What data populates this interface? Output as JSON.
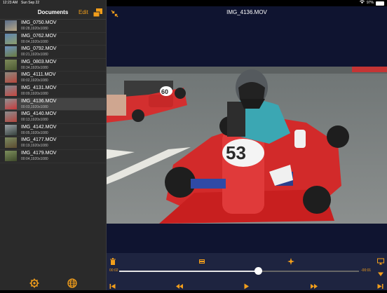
{
  "status": {
    "time": "12:23 AM",
    "date": "Sun Sep 22",
    "battery": "97%"
  },
  "sidebar": {
    "title": "Documents",
    "edit_label": "Edit",
    "files": [
      {
        "name": "IMG_0750.MOV",
        "meta": "00:28,1920x1080"
      },
      {
        "name": "IMG_0762.MOV",
        "meta": "00:04,1920x1080"
      },
      {
        "name": "IMG_0792.MOV",
        "meta": "00:21,1920x1080"
      },
      {
        "name": "IMG_0803.MOV",
        "meta": "00:34,1920x1080"
      },
      {
        "name": "IMG_4111.MOV",
        "meta": "00:02,1920x1080"
      },
      {
        "name": "IMG_4131.MOV",
        "meta": "00:09,1920x1080"
      },
      {
        "name": "IMG_4136.MOV",
        "meta": "00:03,1920x1080",
        "selected": true
      },
      {
        "name": "IMG_4140.MOV",
        "meta": "00:13,1920x1080"
      },
      {
        "name": "IMG_4142.MOV",
        "meta": "00:05,1920x1080"
      },
      {
        "name": "IMG_4177.MOV",
        "meta": "00:19,1920x1080"
      },
      {
        "name": "IMG_4179.MOV",
        "meta": "00:04,1920x1080"
      }
    ]
  },
  "player": {
    "title": "IMG_4136.MOV",
    "current_time": "00:02",
    "remaining_time": "-00:01",
    "progress": 0.58,
    "kart_number": "53",
    "kart_number_rear": "60"
  },
  "colors": {
    "accent": "#f29e1b",
    "sidebar_bg": "#2a2a2a",
    "player_bg": "#0f1430",
    "controls_bg": "#1e2440"
  }
}
